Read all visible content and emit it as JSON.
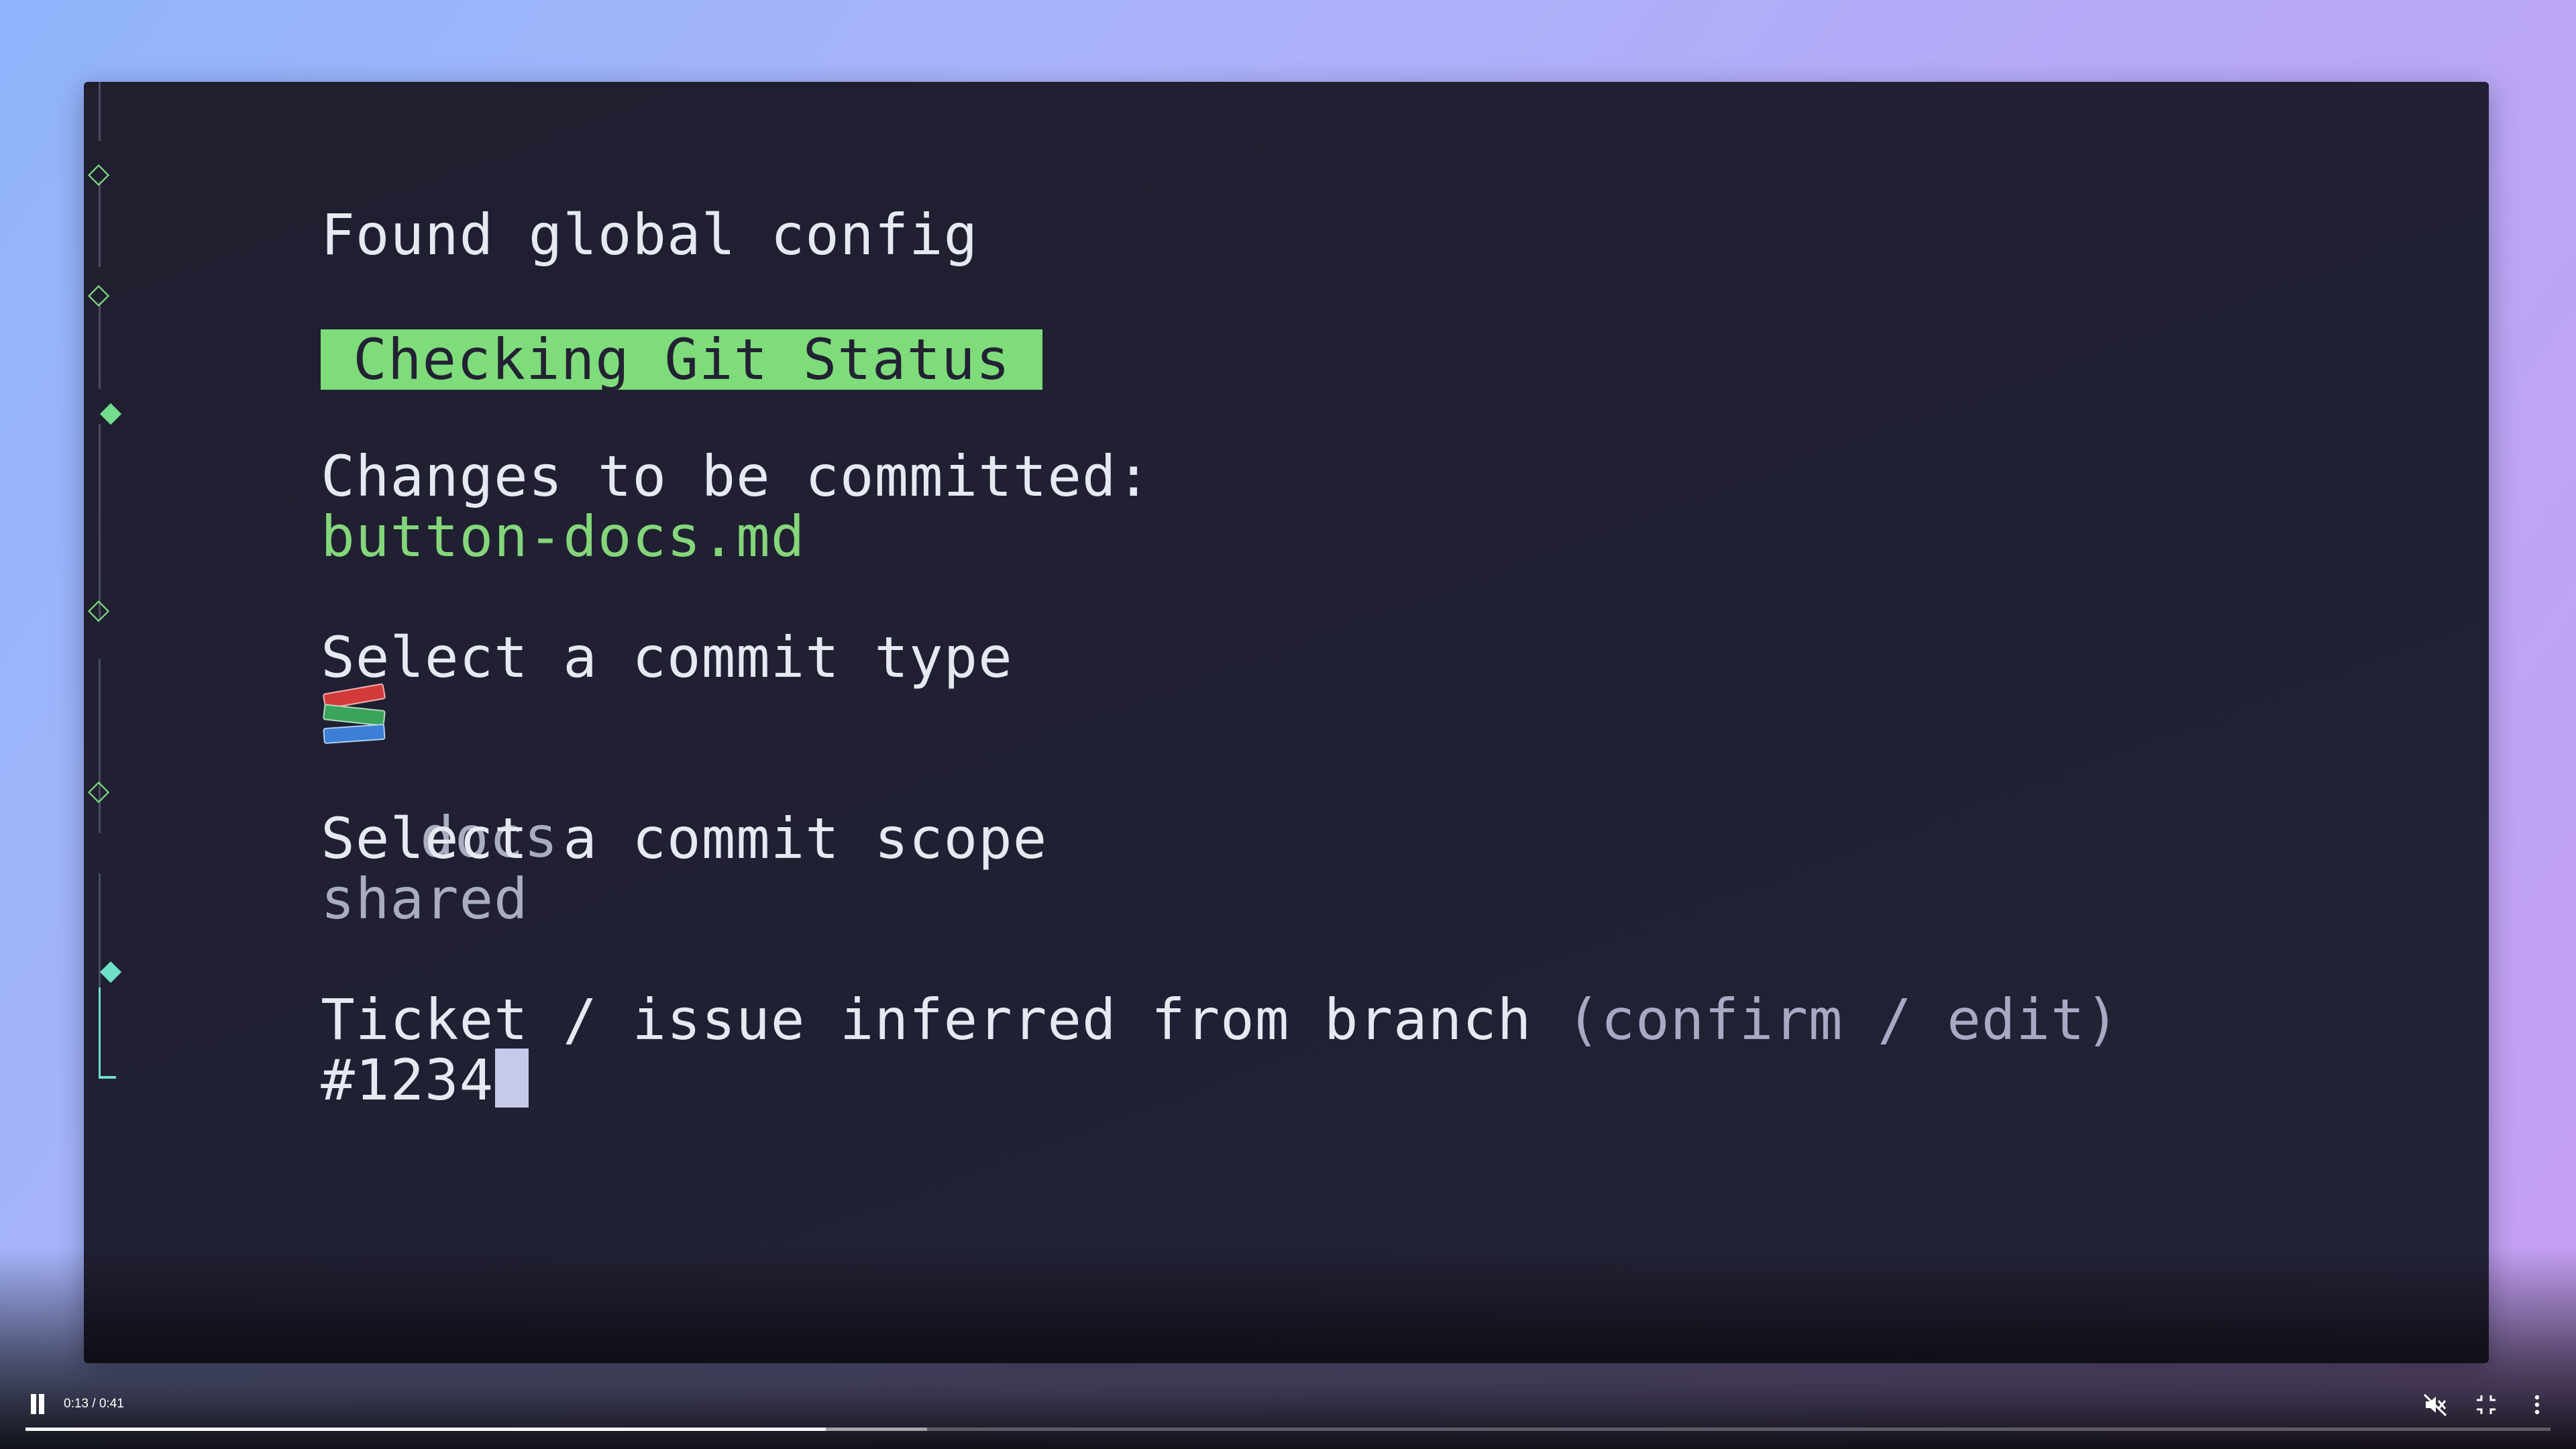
{
  "terminal": {
    "found_config": "Found global config",
    "section_badge": "Checking Git Status",
    "changes_label": "Changes to be committed:",
    "changed_file": "button-docs.md",
    "commit_type_prompt": "Select a commit type",
    "commit_type_value": "docs",
    "commit_type_icon": "books-icon",
    "commit_scope_prompt": "Select a commit scope",
    "commit_scope_value": "shared",
    "ticket_prompt": "Ticket / issue inferred from branch",
    "ticket_hint": "(confirm / edit)",
    "ticket_value": "#1234"
  },
  "colors": {
    "accent_green": "#7fdc7a",
    "active_teal": "#6fe0c8",
    "terminal_bg": "#1f1f30"
  },
  "player": {
    "time": "0:13 / 0:41",
    "progress_fraction": 0.317,
    "buffered_fraction": 0.357,
    "muted": true,
    "icons": [
      "pause-icon",
      "volume-muted-icon",
      "exit-fullscreen-icon",
      "more-options-icon"
    ]
  }
}
